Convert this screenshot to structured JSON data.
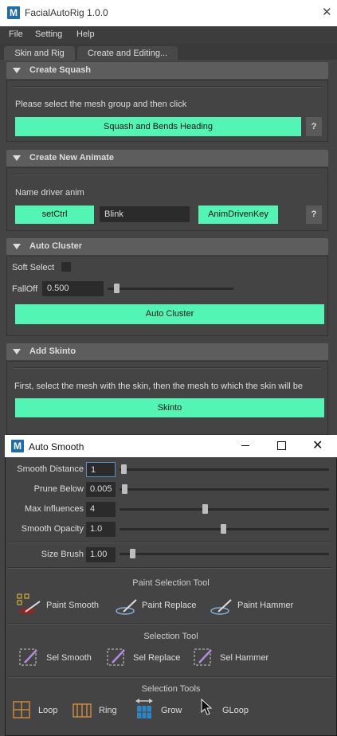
{
  "main_window": {
    "title": "FacialAutoRig 1.0.0",
    "logo": "M",
    "close_glyph": "✕"
  },
  "menu": [
    "File",
    "Setting",
    "Help"
  ],
  "tabs": [
    "Skin and Rig",
    "Create and Editing..."
  ],
  "create_squash": {
    "header": "Create Squash",
    "instruction": "Please select the mesh group and then click",
    "button": "Squash and Bends Heading",
    "help": "?"
  },
  "create_new_animate": {
    "header": "Create New Animate",
    "label": "Name driver anim",
    "set_ctrl": "setCtrl",
    "name_value": "Blink",
    "anim_driven_key": "AnimDrivenKey",
    "help": "?"
  },
  "auto_cluster": {
    "header": "Auto Cluster",
    "soft_select_label": "Soft Select",
    "soft_select_checked": false,
    "falloff_label": "FallOff",
    "falloff_value": "0.500",
    "button": "Auto Cluster"
  },
  "add_skinto": {
    "header": "Add Skinto",
    "instruction": "First, select the mesh with the skin, then the mesh to which the skin will be",
    "button": "Skinto"
  },
  "auto_smooth": {
    "title": "Auto Smooth",
    "logo": "M",
    "params": [
      {
        "label": "Smooth Distance",
        "value": "1",
        "level": 0.0
      },
      {
        "label": "Prune Below",
        "value": "0.005",
        "level": 0.02
      },
      {
        "label": "Max Influences",
        "value": "4",
        "level": 0.41
      },
      {
        "label": "Smooth Opacity",
        "value": "1.0",
        "level": 0.5
      }
    ],
    "size_brush": {
      "label": "Size Brush",
      "value": "1.00",
      "level": 0.05
    },
    "paint_selection_title": "Paint Selection Tool",
    "paint_tools": [
      "Paint Smooth",
      "Paint Replace",
      "Paint Hammer"
    ],
    "selection_title": "Selection Tool",
    "selection_tools": [
      "Sel Smooth",
      "Sel Replace",
      "Sel Hammer"
    ],
    "selection_tools_title": "Selection Tools",
    "grow_tools": [
      "Loop",
      "Ring",
      "Grow",
      "GLoop"
    ]
  },
  "colors": {
    "accent_green": "#52f5b3",
    "panel_bg": "#444444",
    "header_bg": "#5d5d5d"
  }
}
